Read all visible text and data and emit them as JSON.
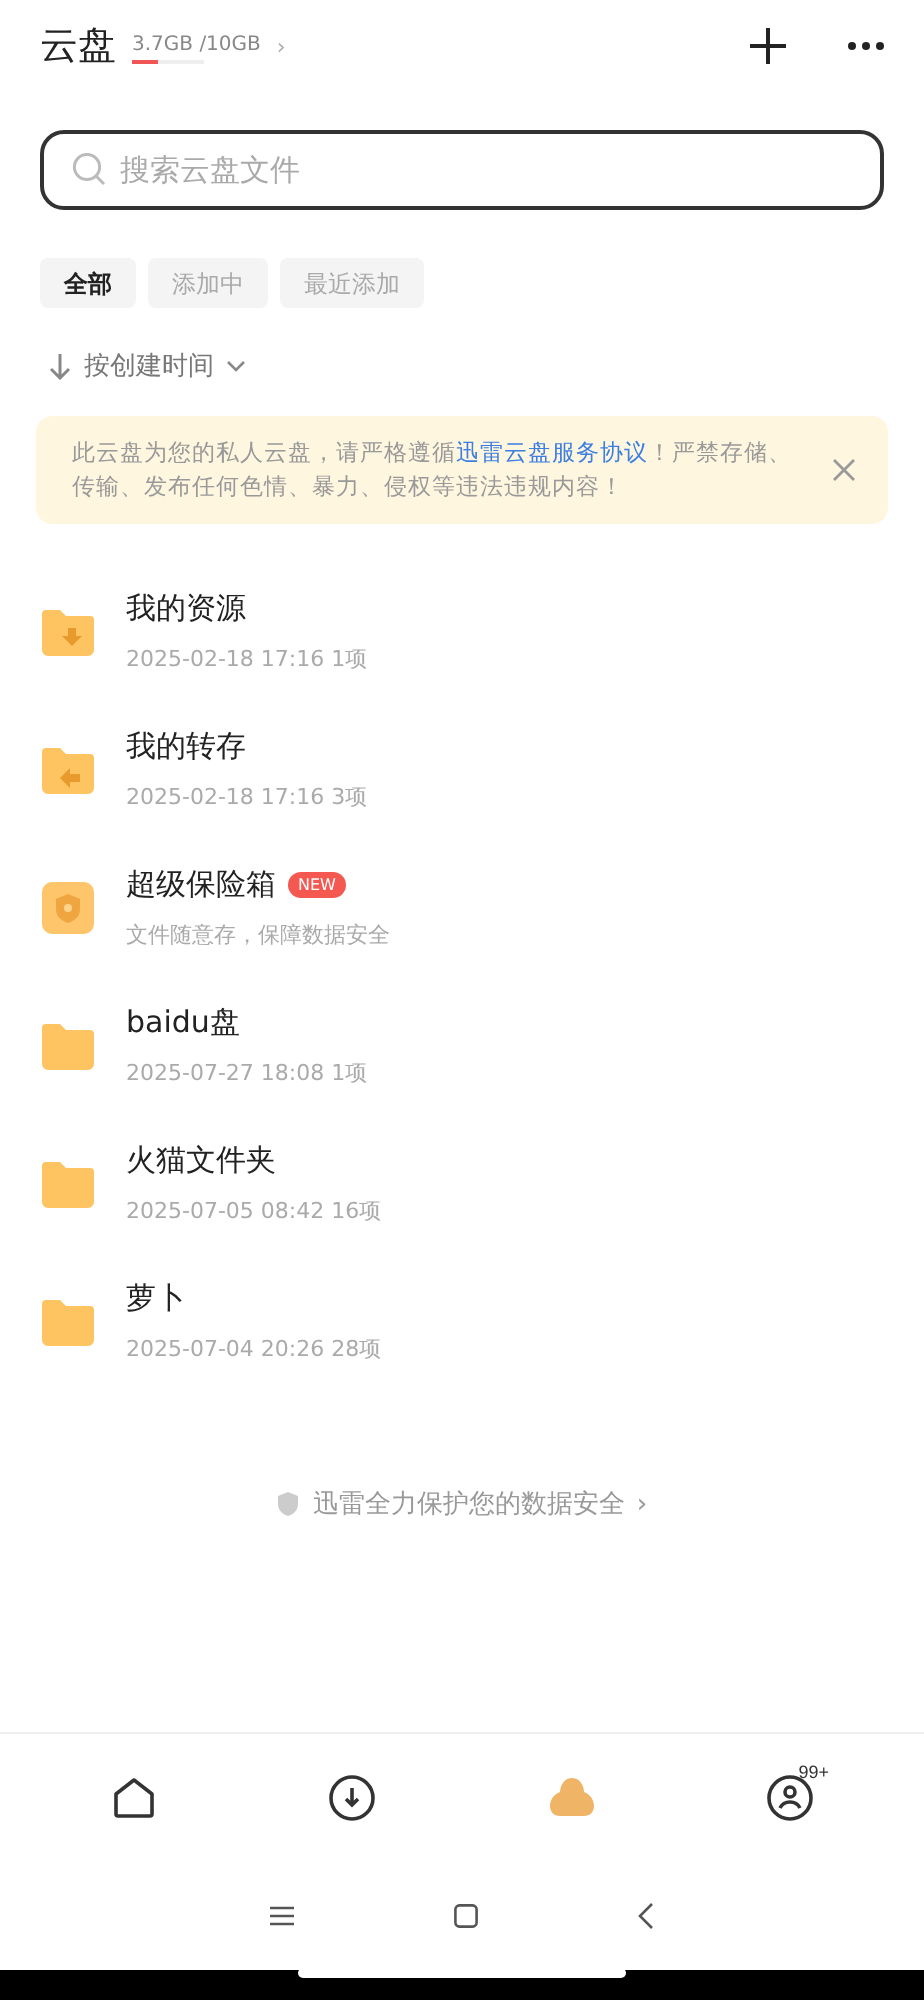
{
  "header": {
    "title": "云盘",
    "storage": {
      "text": "3.7GB /10GB",
      "level": 0.37
    },
    "chevron": "›"
  },
  "search": {
    "placeholder": "搜索云盘文件"
  },
  "filters": [
    {
      "label": "全部",
      "selected": true
    },
    {
      "label": "添加中",
      "selected": false
    },
    {
      "label": "最近添加",
      "selected": false
    }
  ],
  "sort": {
    "label": "按创建时间"
  },
  "notice": {
    "before": "此云盘为您的私人云盘，请严格遵循",
    "link": "迅雷云盘服务协议",
    "after": "！严禁存储、传输、发布任何色情、暴力、侵权等违法违规内容！"
  },
  "folders": [
    {
      "kind": "download",
      "name": "我的资源",
      "meta": "2025-02-18 17:16 1项"
    },
    {
      "kind": "transfer",
      "name": "我的转存",
      "meta": "2025-02-18 17:16 3项"
    },
    {
      "kind": "safe",
      "name": "超级保险箱",
      "badge": "NEW",
      "meta": "文件随意存，保障数据安全"
    },
    {
      "kind": "plain",
      "name": "baidu盘",
      "meta": "2025-07-27 18:08 1项"
    },
    {
      "kind": "plain",
      "name": "火猫文件夹",
      "meta": "2025-07-05 08:42 16项"
    },
    {
      "kind": "plain",
      "name": "萝卜",
      "meta": "2025-07-04 20:26 28项"
    }
  ],
  "footer_note": {
    "text": "迅雷全力保护您的数据安全",
    "chevron": "›"
  },
  "tab_bar": [
    {
      "kind": "home",
      "selected": false
    },
    {
      "kind": "download",
      "selected": false
    },
    {
      "kind": "cloud",
      "selected": true
    },
    {
      "kind": "profile",
      "selected": false,
      "badge": "99+"
    }
  ]
}
